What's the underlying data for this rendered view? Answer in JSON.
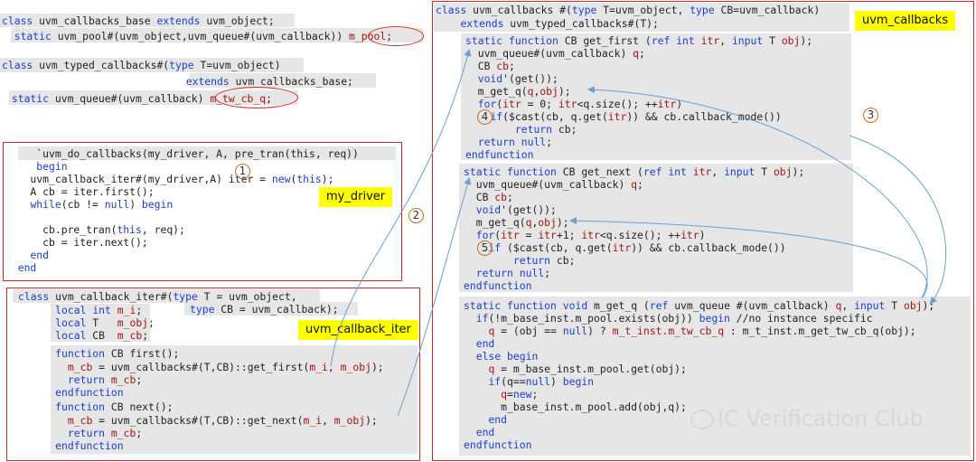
{
  "colors": {
    "keyword": "#1a3fd0",
    "string": "#a31515",
    "frame": "#d42626",
    "highlight": "#ffff00",
    "arrow": "#6aa0d0",
    "circle": "#d2691e"
  },
  "labels": {
    "my_driver": "my_driver",
    "callback_iter": "uvm_callback_iter",
    "callbacks": "uvm_callbacks"
  },
  "circles": {
    "c1": "1",
    "c2": "2",
    "c3": "3",
    "c4": "4",
    "c5": "5"
  },
  "watermark": "IC Verification Club",
  "left_top": {
    "l1": [
      [
        "class",
        "k"
      ],
      [
        " uvm_callbacks_base ",
        ""
      ],
      [
        "extends",
        "k"
      ],
      [
        " uvm_object;",
        ""
      ]
    ],
    "l2": [
      [
        "  ",
        ""
      ],
      [
        "static",
        "k"
      ],
      [
        " uvm_pool#(uvm_object,uvm_queue#(uvm_callback)) ",
        ""
      ],
      [
        "m_pool",
        "s"
      ],
      [
        ";",
        ""
      ]
    ],
    "l3": [
      [
        "class",
        "k"
      ],
      [
        " uvm_typed_callbacks#(",
        ""
      ],
      [
        "type",
        "k"
      ],
      [
        " T=uvm_object)",
        ""
      ]
    ],
    "l4": [
      [
        "                              ",
        ""
      ],
      [
        "extends",
        "k"
      ],
      [
        " uvm_callbacks_base;",
        ""
      ]
    ],
    "l5": [
      [
        " ",
        ""
      ],
      [
        "static",
        "k"
      ],
      [
        " uvm_queue#(uvm_callback) ",
        ""
      ],
      [
        "m_tw_cb_q",
        "s"
      ],
      [
        ";",
        ""
      ]
    ]
  },
  "driver": {
    "l1": [
      [
        "     `uvm_do_callbacks(my_driver, A, pre_tran(this, req))",
        ""
      ]
    ],
    "l2": [
      [
        "     ",
        ""
      ],
      [
        "begin",
        "k"
      ]
    ],
    "l3": [
      [
        "    uvm_callback_iter#(my_driver,A) iter = ",
        ""
      ],
      [
        "new",
        "k"
      ],
      [
        "(",
        ""
      ],
      [
        "this",
        "k"
      ],
      [
        ");",
        ""
      ]
    ],
    "l4": [
      [
        "    A cb = iter.first();",
        ""
      ]
    ],
    "l5": [
      [
        "    ",
        ""
      ],
      [
        "while",
        "k"
      ],
      [
        "(cb != ",
        ""
      ],
      [
        "null",
        "k"
      ],
      [
        ") ",
        ""
      ],
      [
        "begin",
        "k"
      ]
    ],
    "l6": [
      [
        "",
        ""
      ]
    ],
    "l7": [
      [
        "      cb.pre_tran(",
        ""
      ],
      [
        "this",
        "k"
      ],
      [
        ", req);",
        ""
      ]
    ],
    "l8": [
      [
        "      cb = iter.next();",
        ""
      ]
    ],
    "l9": [
      [
        "    ",
        ""
      ],
      [
        "end",
        "k"
      ]
    ],
    "l10": [
      [
        "  ",
        ""
      ],
      [
        "end",
        "k"
      ]
    ]
  },
  "iter": {
    "l1": [
      [
        "class",
        "k"
      ],
      [
        " uvm_callback_iter#(",
        ""
      ],
      [
        "type",
        "k"
      ],
      [
        " T = uvm_object,",
        ""
      ]
    ],
    "l2": [
      [
        "      ",
        ""
      ],
      [
        "local",
        "k"
      ],
      [
        " ",
        ""
      ],
      [
        "int",
        "k"
      ],
      [
        " ",
        ""
      ],
      [
        "m_i",
        "s"
      ],
      [
        ";",
        ""
      ]
    ],
    "l2b": [
      [
        "type",
        "k"
      ],
      [
        " CB = uvm_callback);",
        ""
      ]
    ],
    "l3": [
      [
        "      ",
        ""
      ],
      [
        "local",
        "k"
      ],
      [
        " T   ",
        ""
      ],
      [
        "m_obj",
        "s"
      ],
      [
        ";",
        ""
      ]
    ],
    "l4": [
      [
        "      ",
        ""
      ],
      [
        "local",
        "k"
      ],
      [
        " CB  ",
        ""
      ],
      [
        "m_cb",
        "s"
      ],
      [
        ";",
        ""
      ]
    ],
    "l5": [
      [
        "      ",
        ""
      ],
      [
        "function",
        "k"
      ],
      [
        " CB first();",
        ""
      ]
    ],
    "l6": [
      [
        "        ",
        ""
      ],
      [
        "m_cb",
        "s"
      ],
      [
        " = uvm_callbacks#(T,CB)::get_first(",
        ""
      ],
      [
        "m_i",
        "s"
      ],
      [
        ", ",
        ""
      ],
      [
        "m_obj",
        "s"
      ],
      [
        ");",
        ""
      ]
    ],
    "l7": [
      [
        "        ",
        ""
      ],
      [
        "return",
        "k"
      ],
      [
        " ",
        ""
      ],
      [
        "m_cb",
        "s"
      ],
      [
        ";",
        ""
      ]
    ],
    "l8": [
      [
        "      ",
        ""
      ],
      [
        "endfunction",
        "k"
      ]
    ],
    "l9": [
      [
        "      ",
        ""
      ],
      [
        "function",
        "k"
      ],
      [
        " CB next();",
        ""
      ]
    ],
    "l10": [
      [
        "        ",
        ""
      ],
      [
        "m_cb",
        "s"
      ],
      [
        " = uvm_callbacks#(T,CB)::get_next(",
        ""
      ],
      [
        "m_i",
        "s"
      ],
      [
        ", ",
        ""
      ],
      [
        "m_obj",
        "s"
      ],
      [
        ");",
        ""
      ]
    ],
    "l11": [
      [
        "        ",
        ""
      ],
      [
        "return",
        "k"
      ],
      [
        " ",
        ""
      ],
      [
        "m_cb",
        "s"
      ],
      [
        ";",
        ""
      ]
    ],
    "l12": [
      [
        "      ",
        ""
      ],
      [
        "endfunction",
        "k"
      ]
    ]
  },
  "cbs": {
    "h1": [
      [
        "class",
        "k"
      ],
      [
        " uvm_callbacks #(",
        ""
      ],
      [
        "type",
        "k"
      ],
      [
        " T=uvm_object, ",
        ""
      ],
      [
        "type",
        "k"
      ],
      [
        " CB=uvm_callback)",
        ""
      ]
    ],
    "h2": [
      [
        "    ",
        ""
      ],
      [
        "extends",
        "k"
      ],
      [
        " uvm_typed_callbacks#(T);",
        ""
      ]
    ],
    "f1": [
      [
        "static",
        "k"
      ],
      [
        " ",
        ""
      ],
      [
        "function",
        "k"
      ],
      [
        " CB get_first (",
        ""
      ],
      [
        "ref",
        "k"
      ],
      [
        " ",
        ""
      ],
      [
        "int",
        "k"
      ],
      [
        " ",
        ""
      ],
      [
        "itr",
        "s"
      ],
      [
        ", ",
        ""
      ],
      [
        "input",
        "k"
      ],
      [
        " T ",
        ""
      ],
      [
        "obj",
        "s"
      ],
      [
        ");",
        ""
      ]
    ],
    "f2": [
      [
        "  uvm_queue#(uvm_callback) ",
        ""
      ],
      [
        "q",
        "s"
      ],
      [
        ";",
        ""
      ]
    ],
    "f3": [
      [
        "  CB ",
        ""
      ],
      [
        "cb",
        "s"
      ],
      [
        ";",
        ""
      ]
    ],
    "f4": [
      [
        "  ",
        ""
      ],
      [
        "void",
        "k"
      ],
      [
        "'(get());",
        ""
      ]
    ],
    "f5": [
      [
        "  m_get_q(",
        ""
      ],
      [
        "q",
        "s"
      ],
      [
        ",",
        ""
      ],
      [
        "obj",
        "s"
      ],
      [
        ");",
        ""
      ]
    ],
    "f6": [
      [
        "  ",
        ""
      ],
      [
        "for",
        "k"
      ],
      [
        "(",
        ""
      ],
      [
        "itr",
        "s"
      ],
      [
        " = 0; ",
        ""
      ],
      [
        "itr",
        "s"
      ],
      [
        "<q.size(); ++",
        ""
      ],
      [
        "itr",
        "s"
      ],
      [
        ")",
        ""
      ]
    ],
    "f7": [
      [
        "    ",
        ""
      ],
      [
        "if",
        "k"
      ],
      [
        "($cast(cb, q.get(",
        ""
      ],
      [
        "itr",
        "s"
      ],
      [
        ")) && cb.callback_mode())",
        ""
      ]
    ],
    "f8": [
      [
        "        ",
        ""
      ],
      [
        "return",
        "k"
      ],
      [
        " cb;",
        ""
      ]
    ],
    "f9": [
      [
        "  ",
        ""
      ],
      [
        "return",
        "k"
      ],
      [
        " ",
        ""
      ],
      [
        "null",
        "k"
      ],
      [
        ";",
        ""
      ]
    ],
    "f10": [
      [
        "endfunction",
        "k"
      ]
    ],
    "n1": [
      [
        "static",
        "k"
      ],
      [
        " ",
        ""
      ],
      [
        "function",
        "k"
      ],
      [
        " CB get_next (",
        ""
      ],
      [
        "ref",
        "k"
      ],
      [
        " ",
        ""
      ],
      [
        "int",
        "k"
      ],
      [
        " ",
        ""
      ],
      [
        "itr",
        "s"
      ],
      [
        ", ",
        ""
      ],
      [
        "input",
        "k"
      ],
      [
        " T ",
        ""
      ],
      [
        "obj",
        "s"
      ],
      [
        ");",
        ""
      ]
    ],
    "n2": [
      [
        "  uvm_queue#(uvm_callback) ",
        ""
      ],
      [
        "q",
        "s"
      ],
      [
        ";",
        ""
      ]
    ],
    "n3": [
      [
        "  CB ",
        ""
      ],
      [
        "cb",
        "s"
      ],
      [
        ";",
        ""
      ]
    ],
    "n4": [
      [
        "  ",
        ""
      ],
      [
        "void",
        "k"
      ],
      [
        "'(get());",
        ""
      ]
    ],
    "n5": [
      [
        "  m_get_q(",
        ""
      ],
      [
        "q",
        "s"
      ],
      [
        ",",
        ""
      ],
      [
        "obj",
        "s"
      ],
      [
        ");",
        ""
      ]
    ],
    "n6": [
      [
        "  ",
        ""
      ],
      [
        "for",
        "k"
      ],
      [
        "(",
        ""
      ],
      [
        "itr",
        "s"
      ],
      [
        " = ",
        ""
      ],
      [
        "itr",
        "s"
      ],
      [
        "+1; ",
        ""
      ],
      [
        "itr",
        "s"
      ],
      [
        "<q.size(); ++",
        ""
      ],
      [
        "itr",
        "s"
      ],
      [
        ")",
        ""
      ]
    ],
    "n7": [
      [
        "    ",
        ""
      ],
      [
        "if",
        "k"
      ],
      [
        " ($cast(cb, q.get(",
        ""
      ],
      [
        "itr",
        "s"
      ],
      [
        ")) && cb.callback_mode())",
        ""
      ]
    ],
    "n8": [
      [
        "        ",
        ""
      ],
      [
        "return",
        "k"
      ],
      [
        " cb;",
        ""
      ]
    ],
    "n9": [
      [
        "  ",
        ""
      ],
      [
        "return",
        "k"
      ],
      [
        " ",
        ""
      ],
      [
        "null",
        "k"
      ],
      [
        ";",
        ""
      ]
    ],
    "n10": [
      [
        "endfunction",
        "k"
      ]
    ],
    "m1": [
      [
        "static",
        "k"
      ],
      [
        " ",
        ""
      ],
      [
        "function",
        "k"
      ],
      [
        " ",
        ""
      ],
      [
        "void",
        "k"
      ],
      [
        " m_get_q (",
        ""
      ],
      [
        "ref",
        "k"
      ],
      [
        " uvm_queue #(uvm_callback) ",
        ""
      ],
      [
        "q",
        "s"
      ],
      [
        ", ",
        ""
      ],
      [
        "input",
        "k"
      ],
      [
        " T ",
        ""
      ],
      [
        "obj",
        "s"
      ],
      [
        ");",
        ""
      ]
    ],
    "m2": [
      [
        "  ",
        ""
      ],
      [
        "if",
        "k"
      ],
      [
        "(!m_base_inst.m_pool.exists(obj)) ",
        ""
      ],
      [
        "begin",
        "k"
      ],
      [
        " //no instance specific",
        ""
      ]
    ],
    "m3": [
      [
        "    ",
        ""
      ],
      [
        "q",
        "s"
      ],
      [
        " = (obj == ",
        ""
      ],
      [
        "null",
        "k"
      ],
      [
        ") ? ",
        ""
      ],
      [
        "m_t_inst.m_tw_cb_q",
        "s"
      ],
      [
        " : m_t_inst.m_get_tw_cb_q(obj);",
        ""
      ]
    ],
    "m4": [
      [
        "  ",
        ""
      ],
      [
        "end",
        "k"
      ]
    ],
    "m5": [
      [
        "  ",
        ""
      ],
      [
        "else",
        "k"
      ],
      [
        " ",
        ""
      ],
      [
        "begin",
        "k"
      ]
    ],
    "m6": [
      [
        "    ",
        ""
      ],
      [
        "q",
        "s"
      ],
      [
        " = m_base_inst.m_pool.get(obj);",
        ""
      ]
    ],
    "m7": [
      [
        "    ",
        ""
      ],
      [
        "if",
        "k"
      ],
      [
        "(q==",
        ""
      ],
      [
        "null",
        "k"
      ],
      [
        ") ",
        ""
      ],
      [
        "begin",
        "k"
      ]
    ],
    "m8": [
      [
        "      ",
        ""
      ],
      [
        "q",
        "s"
      ],
      [
        "=",
        ""
      ],
      [
        "new",
        "k"
      ],
      [
        ";",
        ""
      ]
    ],
    "m9": [
      [
        "      m_base_inst.m_pool.add(obj,q);",
        ""
      ]
    ],
    "m10": [
      [
        "    ",
        ""
      ],
      [
        "end",
        "k"
      ]
    ],
    "m11": [
      [
        "  ",
        ""
      ],
      [
        "end",
        "k"
      ]
    ],
    "m12": [
      [
        "endfunction",
        "k"
      ]
    ]
  }
}
